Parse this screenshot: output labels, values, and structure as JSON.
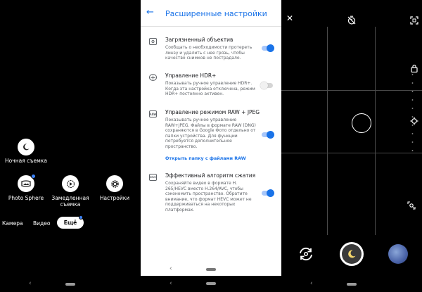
{
  "camera_modes": {
    "night": {
      "label": "Ночная съемка",
      "icon": "moon-icon"
    },
    "photosphere": {
      "label": "Photo Sphere",
      "icon": "panorama-icon"
    },
    "slowmo": {
      "label": "Замедленная\nсъемка",
      "icon": "slow-motion-icon"
    },
    "settings": {
      "label": "Настройки",
      "icon": "gear-icon"
    }
  },
  "mode_tabs": {
    "camera": "Камера",
    "video": "Видео",
    "more": "Ещё",
    "active": "more"
  },
  "navbar": {
    "back": "‹"
  },
  "settings_screen": {
    "title": "Расширенные настройки",
    "items": [
      {
        "title": "Загрязненный объектив",
        "description": "Сообщать о необходимости протереть линзу и удалить с нее грязь, чтобы качество снимков не пострадало.",
        "enabled": true,
        "icon": "lens-icon"
      },
      {
        "title": "Управление HDR+",
        "description": "Показывать ручное управление HDR+. Когда эта настройка отключена, режим HDR+ постоянно активен.",
        "enabled": false,
        "icon": "hdr-icon"
      },
      {
        "title": "Управление режимом RAW + JPEG",
        "description": "Показывать ручное управление RAW+JPEG. Файлы в формате RAW (DNG) сохраняются в Google Фото отдельно от папки устройства. Для функции потребуется дополнительное пространство.",
        "link": "Открыть папку с файлами RAW",
        "enabled": true,
        "icon": "raw-icon",
        "icon_text": "RAW"
      },
      {
        "title": "Эффективный алгоритм сжатия",
        "description": "Сохраняйте видео в формате H. 265/HEVC вместо H.264/AVC, чтобы сэкономить пространство. Обратите внимание, что формат HEVC может не поддерживаться на некоторых платформах.",
        "enabled": true,
        "icon": "hevc-icon",
        "icon_text": "HEVC"
      }
    ]
  },
  "viewfinder": {
    "close_icon": "close-icon",
    "timer_icon": "timer-off-icon",
    "aspect_icon": "aspect-ratio-icon",
    "lock_icon": "lock-icon",
    "exposure_icon": "exposure-icon",
    "zoom_icon": "zoom-icon",
    "switch_camera_icon": "switch-camera-icon",
    "shutter_icon": "night-shutter-icon",
    "thumbnail": "gallery-thumbnail"
  },
  "colors": {
    "accent": "#1a73e8",
    "badge": "#3b82f6"
  }
}
